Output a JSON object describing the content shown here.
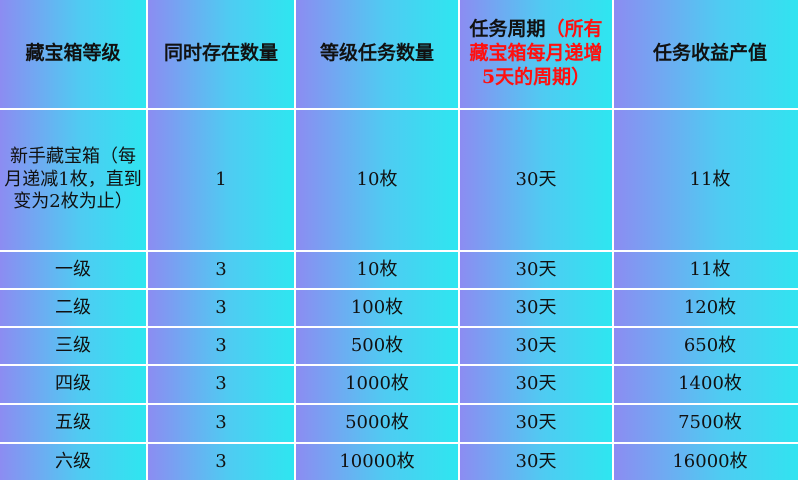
{
  "headers": {
    "level": "藏宝箱等级",
    "simul": "同时存在数量",
    "task_count": "等级任务数量",
    "cycle_prefix": "任务周期",
    "cycle_note": "（所有藏宝箱每月递增5天的周期）",
    "yield": "任务收益产值"
  },
  "rows": [
    {
      "level": "新手藏宝箱（每月递减1枚，直到变为2枚为止）",
      "simul": "1",
      "task_count": "10枚",
      "cycle": "30天",
      "yield": "11枚"
    },
    {
      "level": "一级",
      "simul": "3",
      "task_count": "10枚",
      "cycle": "30天",
      "yield": "11枚"
    },
    {
      "level": "二级",
      "simul": "3",
      "task_count": "100枚",
      "cycle": "30天",
      "yield": "120枚"
    },
    {
      "level": "三级",
      "simul": "3",
      "task_count": "500枚",
      "cycle": "30天",
      "yield": "650枚"
    },
    {
      "level": "四级",
      "simul": "3",
      "task_count": "1000枚",
      "cycle": "30天",
      "yield": "1400枚"
    },
    {
      "level": "五级",
      "simul": "3",
      "task_count": "5000枚",
      "cycle": "30天",
      "yield": "7500枚"
    },
    {
      "level": "六级",
      "simul": "3",
      "task_count": "10000枚",
      "cycle": "30天",
      "yield": "16000枚"
    }
  ]
}
